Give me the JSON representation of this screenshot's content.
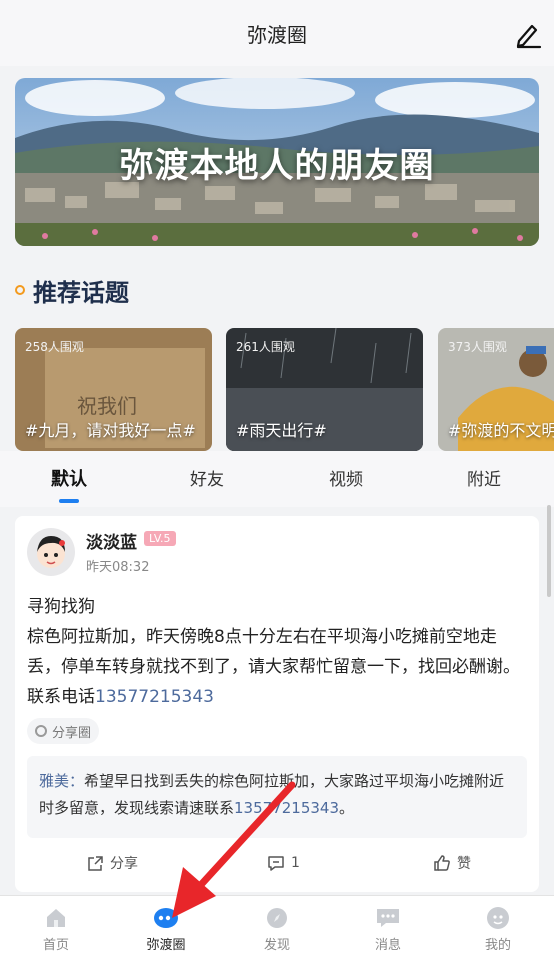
{
  "header": {
    "title": "弥渡圈",
    "edit_icon": "pen-icon"
  },
  "banner": {
    "text": "弥渡本地人的朋友圈"
  },
  "section": {
    "title": "推荐话题",
    "accent_color": "#f39a1e"
  },
  "topics": [
    {
      "viewers": "258人围观",
      "title": "#九月，请对我好一点#"
    },
    {
      "viewers": "261人围观",
      "title": "#雨天出行#"
    },
    {
      "viewers": "373人围观",
      "title": "#弥渡的不文明"
    }
  ],
  "tabs": [
    {
      "label": "默认",
      "active": true
    },
    {
      "label": "好友",
      "active": false
    },
    {
      "label": "视频",
      "active": false
    },
    {
      "label": "附近",
      "active": false
    }
  ],
  "post": {
    "username": "淡淡蓝",
    "level": "LV.5",
    "time": "昨天08:32",
    "line1": "寻狗找狗",
    "body_text": "棕色阿拉斯加，昨天傍晚8点十分左右在平坝海小吃摊前空地走丢，停单车转身就找不到了，请大家帮忙留意一下，找回必酬谢。联系电话",
    "phone": "13577215343",
    "tag": "分享圈",
    "comment": {
      "author": "雅美：",
      "text": "希望早日找到丢失的棕色阿拉斯加，大家路过平坝海小吃摊附近时多留意，发现线索请速联系",
      "phone": "13577215343",
      "end": "。"
    },
    "actions": {
      "share": "分享",
      "comments": "1",
      "like": "赞"
    }
  },
  "bottom_nav": [
    {
      "label": "首页",
      "icon": "home-icon",
      "active": false
    },
    {
      "label": "弥渡圈",
      "icon": "circle-chat-icon",
      "active": true
    },
    {
      "label": "发现",
      "icon": "compass-icon",
      "active": false
    },
    {
      "label": "消息",
      "icon": "message-icon",
      "active": false
    },
    {
      "label": "我的",
      "icon": "profile-icon",
      "active": false
    }
  ],
  "colors": {
    "accent_blue": "#1e7ff0",
    "link_blue": "#4d6a9c",
    "annotation_red": "#e8262a"
  }
}
